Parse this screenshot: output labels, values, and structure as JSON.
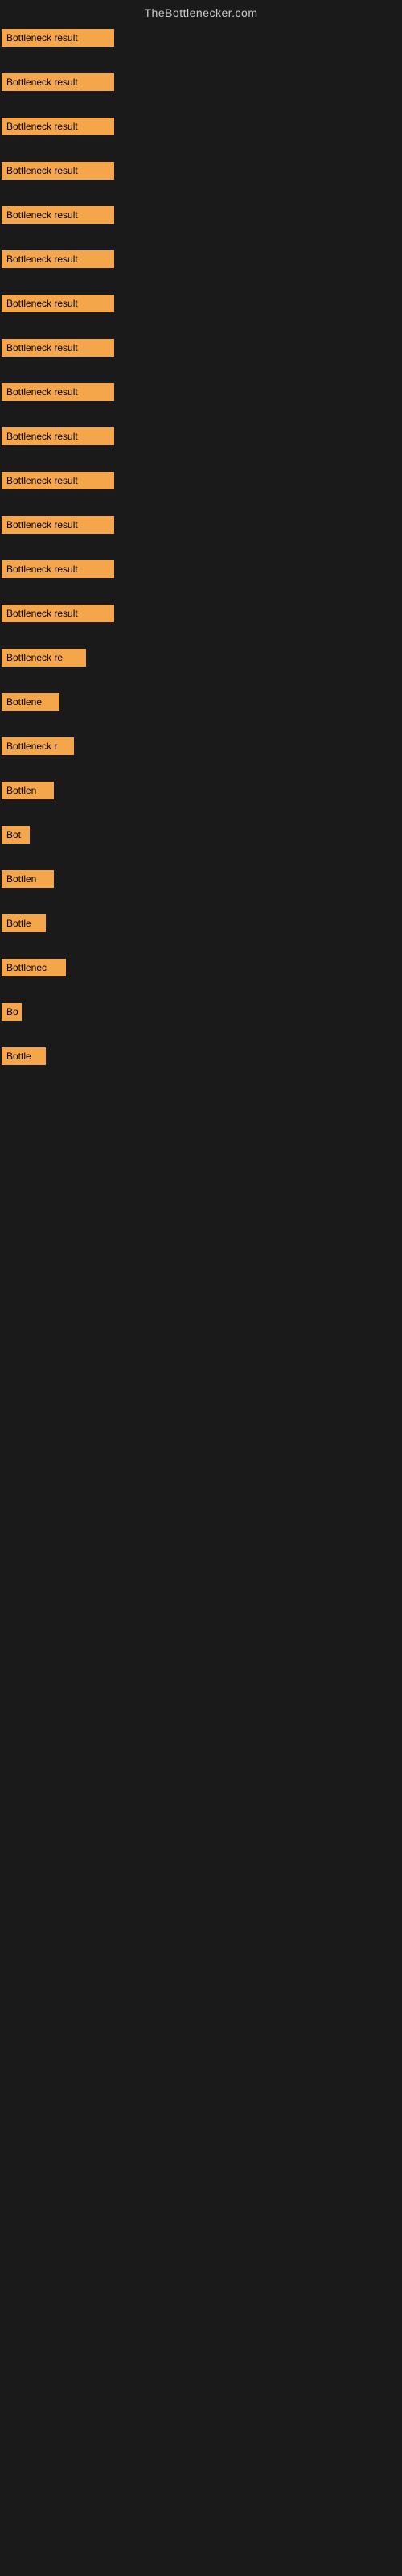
{
  "site": {
    "title": "TheBottlenecker.com"
  },
  "items": [
    {
      "label": "Bottleneck result",
      "width": 140
    },
    {
      "label": "Bottleneck result",
      "width": 140
    },
    {
      "label": "Bottleneck result",
      "width": 140
    },
    {
      "label": "Bottleneck result",
      "width": 140
    },
    {
      "label": "Bottleneck result",
      "width": 140
    },
    {
      "label": "Bottleneck result",
      "width": 140
    },
    {
      "label": "Bottleneck result",
      "width": 140
    },
    {
      "label": "Bottleneck result",
      "width": 140
    },
    {
      "label": "Bottleneck result",
      "width": 140
    },
    {
      "label": "Bottleneck result",
      "width": 140
    },
    {
      "label": "Bottleneck result",
      "width": 140
    },
    {
      "label": "Bottleneck result",
      "width": 140
    },
    {
      "label": "Bottleneck result",
      "width": 140
    },
    {
      "label": "Bottleneck result",
      "width": 140
    },
    {
      "label": "Bottleneck re",
      "width": 105
    },
    {
      "label": "Bottlene",
      "width": 72
    },
    {
      "label": "Bottleneck r",
      "width": 90
    },
    {
      "label": "Bottlen",
      "width": 65
    },
    {
      "label": "Bot",
      "width": 35
    },
    {
      "label": "Bottlen",
      "width": 65
    },
    {
      "label": "Bottle",
      "width": 55
    },
    {
      "label": "Bottlenec",
      "width": 80
    },
    {
      "label": "Bo",
      "width": 25
    },
    {
      "label": "Bottle",
      "width": 55
    }
  ]
}
